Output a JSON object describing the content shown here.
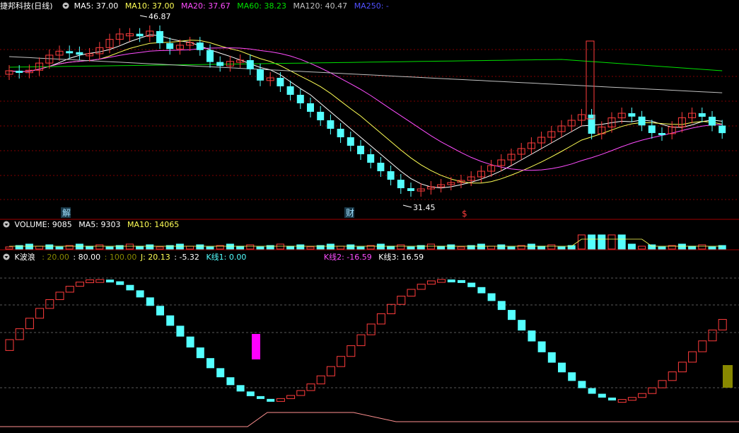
{
  "header": {
    "title": "捷邦科技(日线)",
    "ma5": "MA5: 37.00",
    "ma10": "MA10: 37.00",
    "ma20": "MA20: 37.67",
    "ma60": "MA60: 38.23",
    "ma120": "MA120: 40.47",
    "ma250": "MA250: -"
  },
  "price_annotations": {
    "high": "46.87",
    "low": "31.45"
  },
  "markers": {
    "jie": "解",
    "cai": "财",
    "s": "$"
  },
  "volume_header": {
    "title": "VOLUME: 9085",
    "ma5": "MA5: 9303",
    "ma10": "MA10: 14065"
  },
  "kwave_header": {
    "title": "K波浪",
    "v1": ": 20.00",
    "v2": ": 80.00",
    "v3": ": 100.00",
    "j": "J: 20.13",
    "neg": ": -5.32",
    "k1": "K线1: 0.00",
    "k2": "K线2: -16.59",
    "k3": "K线3: 16.59"
  },
  "colors": {
    "up": "#ff3c3c",
    "down": "#54ffff",
    "ma5": "#ffffff",
    "ma10": "#ffff55",
    "ma20": "#ff4dff",
    "ma60": "#00e000",
    "ma120": "#c0c0c0",
    "grid": "#800000"
  }
}
